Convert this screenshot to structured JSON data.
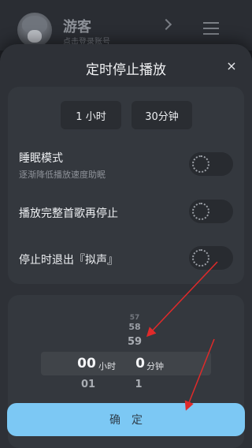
{
  "profile": {
    "username": "游客",
    "login_hint": "点击登录账号"
  },
  "dialog": {
    "title": "定时停止播放",
    "close_label": "×"
  },
  "durations": [
    {
      "label": "1 小时"
    },
    {
      "label": "30分钟"
    }
  ],
  "options": {
    "sleep_mode": {
      "label": "睡眠模式",
      "description": "逐渐降低播放速度助眠",
      "enabled": false
    },
    "finish_song": {
      "label": "播放完整首歌再停止",
      "enabled": false
    },
    "quit_app": {
      "label": "停止时退出『拟声』",
      "enabled": false
    }
  },
  "picker": {
    "hours": {
      "selected": "00",
      "below": "01",
      "unit": "小时"
    },
    "minutes": {
      "above_far": "57",
      "above_mid": "58",
      "above_near": "59",
      "selected": "0",
      "below": "1",
      "unit": "分钟"
    }
  },
  "confirm_label": "确定",
  "colors": {
    "accent": "#7cc8f4",
    "annotation_arrow": "#e02a2a",
    "sheet_bg": "#2e3137",
    "card_bg": "#34383e"
  }
}
